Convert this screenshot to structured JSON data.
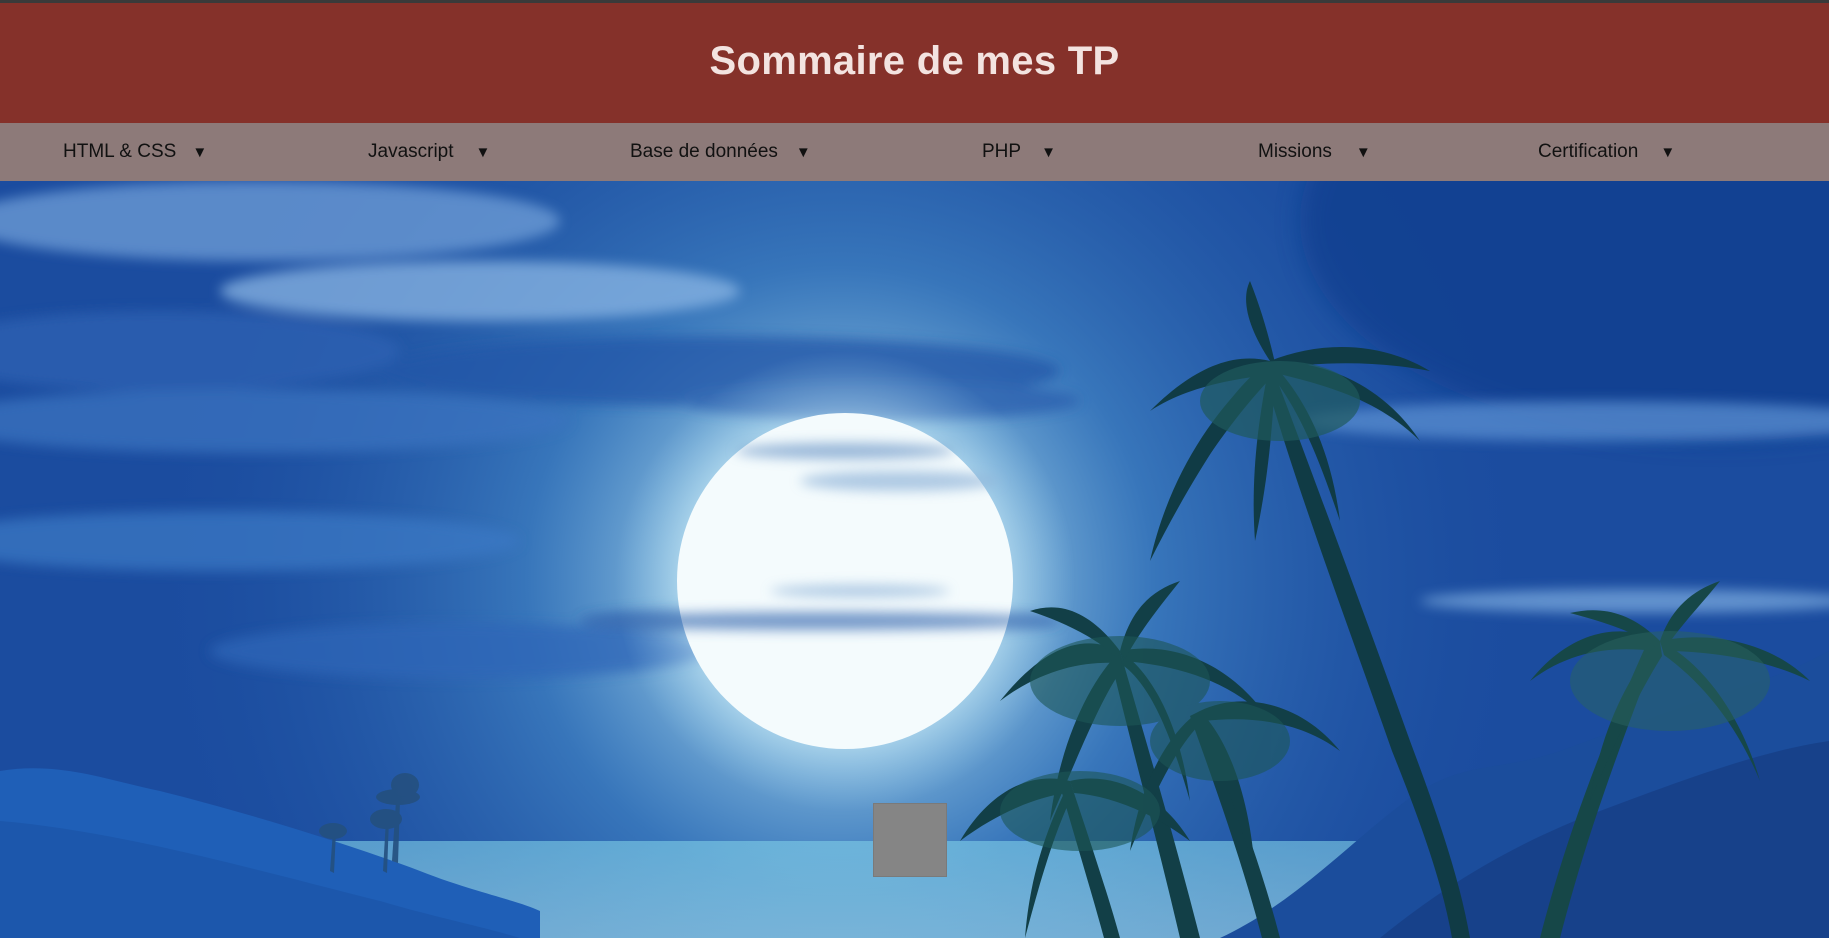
{
  "header": {
    "title": "Sommaire de mes TP"
  },
  "nav": {
    "items": [
      {
        "label": "HTML & CSS",
        "arrow": "▼"
      },
      {
        "label": "Javascript",
        "arrow": "▼"
      },
      {
        "label": "Base de données",
        "arrow": "▼"
      },
      {
        "label": "PHP",
        "arrow": "▼"
      },
      {
        "label": "Missions",
        "arrow": "▼"
      },
      {
        "label": "Certification",
        "arrow": "▼"
      }
    ]
  },
  "hero": {
    "image": "night-beach-moon-palm-trees"
  },
  "colors": {
    "header_bg": "#85312a",
    "header_text": "#f3e3e0",
    "nav_bg": "#8d7a79",
    "nav_text": "#111111",
    "box": "#858585"
  }
}
